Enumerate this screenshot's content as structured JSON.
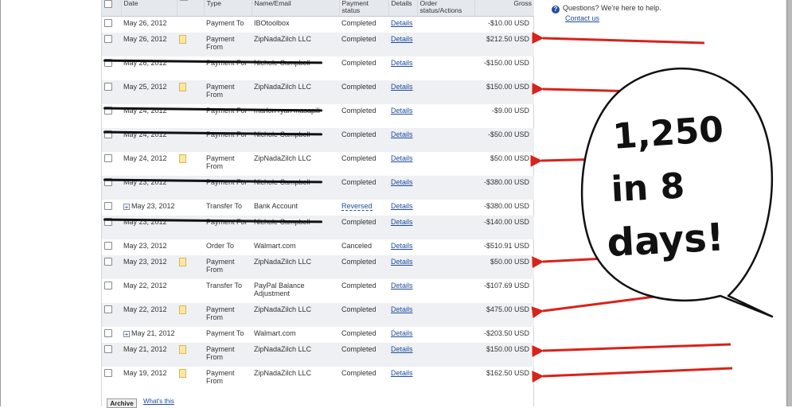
{
  "table": {
    "headers": [
      "Date",
      "Type",
      "Name/Email",
      "Payment status",
      "Details",
      "Order status/Actions",
      "Gross"
    ],
    "rows": [
      {
        "date": "May 26, 2012",
        "icon": "",
        "type": "Payment To",
        "name": "IBOtoolbox",
        "status": "Completed",
        "details": "Details",
        "gross": "-$10.00 USD",
        "struck": false
      },
      {
        "date": "May 26, 2012",
        "icon": "doc",
        "type": "Payment From",
        "name": "ZipNadaZilch LLC",
        "status": "Completed",
        "details": "Details",
        "gross": "$212.50 USD",
        "struck": false
      },
      {
        "date": "May 26, 2012",
        "icon": "",
        "type": "Payment For",
        "name": "Nichole Campbell",
        "status": "Completed",
        "details": "Details",
        "gross": "-$150.00 USD",
        "struck": true
      },
      {
        "date": "May 25, 2012",
        "icon": "doc",
        "type": "Payment From",
        "name": "ZipNadaZilch LLC",
        "status": "Completed",
        "details": "Details",
        "gross": "$150.00 USD",
        "struck": false
      },
      {
        "date": "May 24, 2012",
        "icon": "",
        "type": "Payment For",
        "name": "marlon ryan masapili",
        "status": "Completed",
        "details": "Details",
        "gross": "-$9.00 USD",
        "struck": true
      },
      {
        "date": "May 24, 2012",
        "icon": "",
        "type": "Payment For",
        "name": "Nichole Campbell",
        "status": "Completed",
        "details": "Details",
        "gross": "-$50.00 USD",
        "struck": true
      },
      {
        "date": "May 24, 2012",
        "icon": "doc",
        "type": "Payment From",
        "name": "ZipNadaZilch LLC",
        "status": "Completed",
        "details": "Details",
        "gross": "$50.00 USD",
        "struck": false
      },
      {
        "date": "May 23, 2012",
        "icon": "",
        "type": "Payment For",
        "name": "Nichole Campbell",
        "status": "Completed",
        "details": "Details",
        "gross": "-$380.00 USD",
        "struck": true
      },
      {
        "date": "May 23, 2012",
        "icon": "plus",
        "type": "Transfer To",
        "name": "Bank Account",
        "status": "Reversed",
        "details": "Details",
        "gross": "-$380.00 USD",
        "struck": false
      },
      {
        "date": "May 23, 2012",
        "icon": "",
        "type": "Payment For",
        "name": "Nichole Campbell",
        "status": "Completed",
        "details": "Details",
        "gross": "-$140.00 USD",
        "struck": true
      },
      {
        "date": "May 23, 2012",
        "icon": "",
        "type": "Order To",
        "name": "Walmart.com",
        "status": "Canceled",
        "details": "Details",
        "gross": "-$510.91 USD",
        "struck": false
      },
      {
        "date": "May 23, 2012",
        "icon": "doc",
        "type": "Payment From",
        "name": "ZipNadaZilch LLC",
        "status": "Completed",
        "details": "Details",
        "gross": "$50.00 USD",
        "struck": false
      },
      {
        "date": "May 22, 2012",
        "icon": "",
        "type": "Transfer To",
        "name": "PayPal Balance Adjustment",
        "status": "Completed",
        "details": "Details",
        "gross": "-$107.69 USD",
        "struck": false
      },
      {
        "date": "May 22, 2012",
        "icon": "doc",
        "type": "Payment From",
        "name": "ZipNadaZilch LLC",
        "status": "Completed",
        "details": "Details",
        "gross": "$475.00 USD",
        "struck": false
      },
      {
        "date": "May 21, 2012",
        "icon": "plus",
        "type": "Payment To",
        "name": "Walmart.com",
        "status": "Completed",
        "details": "Details",
        "gross": "-$203.50 USD",
        "struck": false
      },
      {
        "date": "May 21, 2012",
        "icon": "doc",
        "type": "Payment From",
        "name": "ZipNadaZilch LLC",
        "status": "Completed",
        "details": "Details",
        "gross": "$150.00 USD",
        "struck": false
      },
      {
        "date": "May 19, 2012",
        "icon": "doc",
        "type": "Payment From",
        "name": "ZipNadaZilch LLC",
        "status": "Completed",
        "details": "Details",
        "gross": "$162.50 USD",
        "struck": false
      }
    ]
  },
  "footer": {
    "archive_label": "Archive",
    "whats_this": "What's this"
  },
  "help": {
    "question": "Questions? We're here to help.",
    "contact": "Contact us"
  },
  "bubble": {
    "line1": "1,250",
    "line2": "in 8",
    "line3": "days!"
  },
  "colors": {
    "arrow": "#d8231a",
    "header_bg": "#e5e9ee",
    "alt_row": "#eef0f3",
    "link": "#1c4b9c"
  }
}
